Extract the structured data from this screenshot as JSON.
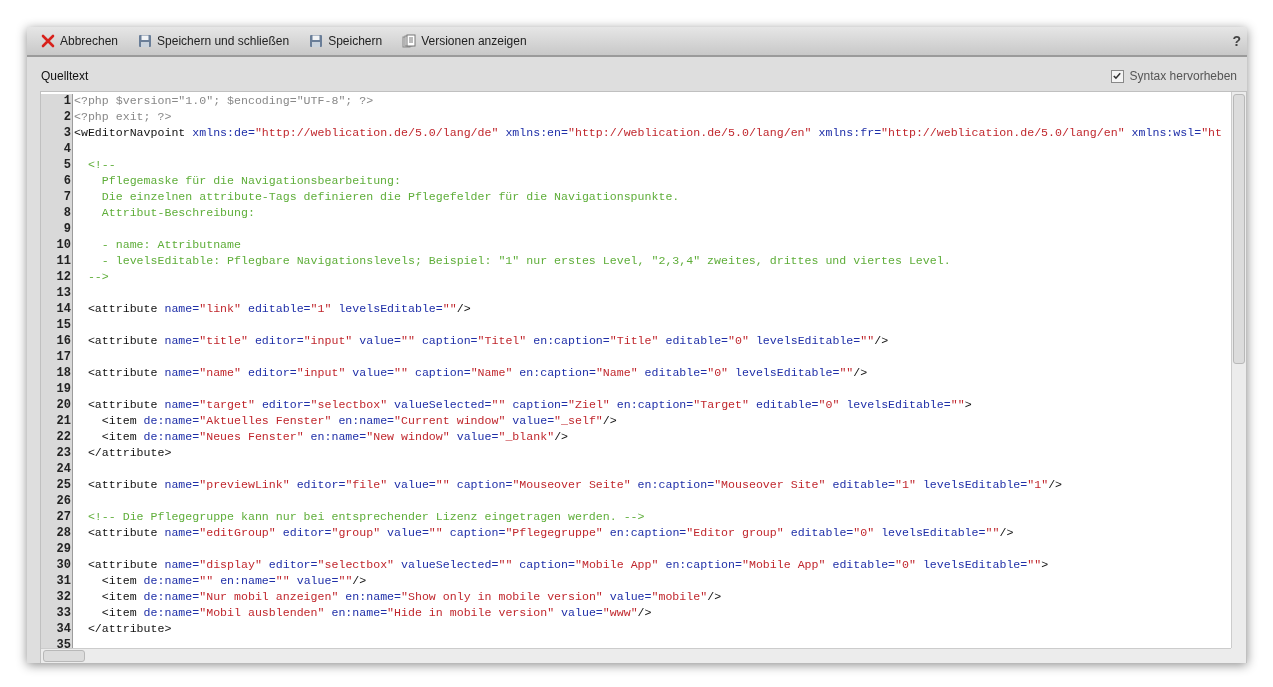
{
  "toolbar": {
    "buttons": [
      {
        "kind": "cancel",
        "label": "Abbrechen"
      },
      {
        "kind": "save",
        "label": "Speichern und schließen"
      },
      {
        "kind": "save",
        "label": "Speichern"
      },
      {
        "kind": "versions",
        "label": "Versionen anzeigen"
      }
    ],
    "help": "?"
  },
  "panel": {
    "title": "Quelltext",
    "highlight_option": {
      "label": "Syntax hervorheben",
      "checked": true
    }
  },
  "editor": {
    "lines": [
      {
        "number": "1",
        "tokens": [
          {
            "kind": "php",
            "text": "<?php $version=\"1.0\"; $encoding=\"UTF-8\"; ?>"
          }
        ]
      },
      {
        "number": "2",
        "tokens": [
          {
            "kind": "php",
            "text": "<?php exit; ?>"
          }
        ]
      },
      {
        "number": "3",
        "tokens": [
          {
            "kind": "tag",
            "text": "<wEditorNavpoint"
          },
          {
            "kind": "attr",
            "text": " xmlns:de="
          },
          {
            "kind": "value",
            "text": "\"http://weblication.de/5.0/lang/de\""
          },
          {
            "kind": "attr",
            "text": " xmlns:en="
          },
          {
            "kind": "value",
            "text": "\"http://weblication.de/5.0/lang/en\""
          },
          {
            "kind": "attr",
            "text": " xmlns:fr="
          },
          {
            "kind": "value",
            "text": "\"http://weblication.de/5.0/lang/en\""
          },
          {
            "kind": "attr",
            "text": " xmlns:wsl="
          },
          {
            "kind": "value",
            "text": "\"ht"
          }
        ]
      },
      {
        "number": "4"
      },
      {
        "number": "5",
        "tokens": [
          {
            "kind": "comment",
            "text": "  <!--"
          }
        ]
      },
      {
        "number": "6",
        "tokens": [
          {
            "kind": "comment",
            "text": "    Pflegemaske für die Navigationsbearbeitung:"
          }
        ]
      },
      {
        "number": "7",
        "tokens": [
          {
            "kind": "comment",
            "text": "    Die einzelnen attribute-Tags definieren die Pflegefelder für die Navigationspunkte."
          }
        ]
      },
      {
        "number": "8",
        "tokens": [
          {
            "kind": "comment",
            "text": "    Attribut-Beschreibung:"
          }
        ]
      },
      {
        "number": "9"
      },
      {
        "number": "10",
        "tokens": [
          {
            "kind": "comment",
            "text": "    - name: Attributname"
          }
        ]
      },
      {
        "number": "11",
        "tokens": [
          {
            "kind": "comment",
            "text": "    - levelsEditable: Pflegbare Navigationslevels; Beispiel: \"1\" nur erstes Level, \"2,3,4\" zweites, drittes und viertes Level."
          }
        ]
      },
      {
        "number": "12",
        "tokens": [
          {
            "kind": "comment",
            "text": "  -->"
          }
        ]
      },
      {
        "number": "13"
      },
      {
        "number": "14",
        "tokens": [
          {
            "kind": "tag",
            "text": "  <attribute"
          },
          {
            "kind": "attr",
            "text": " name="
          },
          {
            "kind": "value",
            "text": "\"link\""
          },
          {
            "kind": "attr",
            "text": " editable="
          },
          {
            "kind": "value",
            "text": "\"1\""
          },
          {
            "kind": "attr",
            "text": " levelsEditable="
          },
          {
            "kind": "value",
            "text": "\"\""
          },
          {
            "kind": "tag",
            "text": "/>"
          }
        ]
      },
      {
        "number": "15"
      },
      {
        "number": "16",
        "tokens": [
          {
            "kind": "tag",
            "text": "  <attribute"
          },
          {
            "kind": "attr",
            "text": " name="
          },
          {
            "kind": "value",
            "text": "\"title\""
          },
          {
            "kind": "attr",
            "text": " editor="
          },
          {
            "kind": "value",
            "text": "\"input\""
          },
          {
            "kind": "attr",
            "text": " value="
          },
          {
            "kind": "value",
            "text": "\"\""
          },
          {
            "kind": "attr",
            "text": " caption="
          },
          {
            "kind": "value",
            "text": "\"Titel\""
          },
          {
            "kind": "attr",
            "text": " en:caption="
          },
          {
            "kind": "value",
            "text": "\"Title\""
          },
          {
            "kind": "attr",
            "text": " editable="
          },
          {
            "kind": "value",
            "text": "\"0\""
          },
          {
            "kind": "attr",
            "text": " levelsEditable="
          },
          {
            "kind": "value",
            "text": "\"\""
          },
          {
            "kind": "tag",
            "text": "/>"
          }
        ]
      },
      {
        "number": "17"
      },
      {
        "number": "18",
        "tokens": [
          {
            "kind": "tag",
            "text": "  <attribute"
          },
          {
            "kind": "attr",
            "text": " name="
          },
          {
            "kind": "value",
            "text": "\"name\""
          },
          {
            "kind": "attr",
            "text": " editor="
          },
          {
            "kind": "value",
            "text": "\"input\""
          },
          {
            "kind": "attr",
            "text": " value="
          },
          {
            "kind": "value",
            "text": "\"\""
          },
          {
            "kind": "attr",
            "text": " caption="
          },
          {
            "kind": "value",
            "text": "\"Name\""
          },
          {
            "kind": "attr",
            "text": " en:caption="
          },
          {
            "kind": "value",
            "text": "\"Name\""
          },
          {
            "kind": "attr",
            "text": " editable="
          },
          {
            "kind": "value",
            "text": "\"0\""
          },
          {
            "kind": "attr",
            "text": " levelsEditable="
          },
          {
            "kind": "value",
            "text": "\"\""
          },
          {
            "kind": "tag",
            "text": "/>"
          }
        ]
      },
      {
        "number": "19"
      },
      {
        "number": "20",
        "tokens": [
          {
            "kind": "tag",
            "text": "  <attribute"
          },
          {
            "kind": "attr",
            "text": " name="
          },
          {
            "kind": "value",
            "text": "\"target\""
          },
          {
            "kind": "attr",
            "text": " editor="
          },
          {
            "kind": "value",
            "text": "\"selectbox\""
          },
          {
            "kind": "attr",
            "text": " valueSelected="
          },
          {
            "kind": "value",
            "text": "\"\""
          },
          {
            "kind": "attr",
            "text": " caption="
          },
          {
            "kind": "value",
            "text": "\"Ziel\""
          },
          {
            "kind": "attr",
            "text": " en:caption="
          },
          {
            "kind": "value",
            "text": "\"Target\""
          },
          {
            "kind": "attr",
            "text": " editable="
          },
          {
            "kind": "value",
            "text": "\"0\""
          },
          {
            "kind": "attr",
            "text": " levelsEditable="
          },
          {
            "kind": "value",
            "text": "\"\""
          },
          {
            "kind": "tag",
            "text": ">"
          }
        ]
      },
      {
        "number": "21",
        "tokens": [
          {
            "kind": "tag",
            "text": "    <item"
          },
          {
            "kind": "attr",
            "text": " de:name="
          },
          {
            "kind": "value",
            "text": "\"Aktuelles Fenster\""
          },
          {
            "kind": "attr",
            "text": " en:name="
          },
          {
            "kind": "value",
            "text": "\"Current window\""
          },
          {
            "kind": "attr",
            "text": " value="
          },
          {
            "kind": "value",
            "text": "\"_self\""
          },
          {
            "kind": "tag",
            "text": "/>"
          }
        ]
      },
      {
        "number": "22",
        "tokens": [
          {
            "kind": "tag",
            "text": "    <item"
          },
          {
            "kind": "attr",
            "text": " de:name="
          },
          {
            "kind": "value",
            "text": "\"Neues Fenster\""
          },
          {
            "kind": "attr",
            "text": " en:name="
          },
          {
            "kind": "value",
            "text": "\"New window\""
          },
          {
            "kind": "attr",
            "text": " value="
          },
          {
            "kind": "value",
            "text": "\"_blank\""
          },
          {
            "kind": "tag",
            "text": "/>"
          }
        ]
      },
      {
        "number": "23",
        "tokens": [
          {
            "kind": "tag",
            "text": "  </attribute>"
          }
        ]
      },
      {
        "number": "24"
      },
      {
        "number": "25",
        "tokens": [
          {
            "kind": "tag",
            "text": "  <attribute"
          },
          {
            "kind": "attr",
            "text": " name="
          },
          {
            "kind": "value",
            "text": "\"previewLink\""
          },
          {
            "kind": "attr",
            "text": " editor="
          },
          {
            "kind": "value",
            "text": "\"file\""
          },
          {
            "kind": "attr",
            "text": " value="
          },
          {
            "kind": "value",
            "text": "\"\""
          },
          {
            "kind": "attr",
            "text": " caption="
          },
          {
            "kind": "value",
            "text": "\"Mouseover Seite\""
          },
          {
            "kind": "attr",
            "text": " en:caption="
          },
          {
            "kind": "value",
            "text": "\"Mouseover Site\""
          },
          {
            "kind": "attr",
            "text": " editable="
          },
          {
            "kind": "value",
            "text": "\"1\""
          },
          {
            "kind": "attr",
            "text": " levelsEditable="
          },
          {
            "kind": "value",
            "text": "\"1\""
          },
          {
            "kind": "tag",
            "text": "/>"
          }
        ]
      },
      {
        "number": "26"
      },
      {
        "number": "27",
        "tokens": [
          {
            "kind": "comment",
            "text": "  <!-- Die Pflegegruppe kann nur bei entsprechender Lizenz eingetragen werden. -->"
          }
        ]
      },
      {
        "number": "28",
        "tokens": [
          {
            "kind": "tag",
            "text": "  <attribute"
          },
          {
            "kind": "attr",
            "text": " name="
          },
          {
            "kind": "value",
            "text": "\"editGroup\""
          },
          {
            "kind": "attr",
            "text": " editor="
          },
          {
            "kind": "value",
            "text": "\"group\""
          },
          {
            "kind": "attr",
            "text": " value="
          },
          {
            "kind": "value",
            "text": "\"\""
          },
          {
            "kind": "attr",
            "text": " caption="
          },
          {
            "kind": "value",
            "text": "\"Pflegegruppe\""
          },
          {
            "kind": "attr",
            "text": " en:caption="
          },
          {
            "kind": "value",
            "text": "\"Editor group\""
          },
          {
            "kind": "attr",
            "text": " editable="
          },
          {
            "kind": "value",
            "text": "\"0\""
          },
          {
            "kind": "attr",
            "text": " levelsEditable="
          },
          {
            "kind": "value",
            "text": "\"\""
          },
          {
            "kind": "tag",
            "text": "/>"
          }
        ]
      },
      {
        "number": "29"
      },
      {
        "number": "30",
        "tokens": [
          {
            "kind": "tag",
            "text": "  <attribute"
          },
          {
            "kind": "attr",
            "text": " name="
          },
          {
            "kind": "value",
            "text": "\"display\""
          },
          {
            "kind": "attr",
            "text": " editor="
          },
          {
            "kind": "value",
            "text": "\"selectbox\""
          },
          {
            "kind": "attr",
            "text": " valueSelected="
          },
          {
            "kind": "value",
            "text": "\"\""
          },
          {
            "kind": "attr",
            "text": " caption="
          },
          {
            "kind": "value",
            "text": "\"Mobile App\""
          },
          {
            "kind": "attr",
            "text": " en:caption="
          },
          {
            "kind": "value",
            "text": "\"Mobile App\""
          },
          {
            "kind": "attr",
            "text": " editable="
          },
          {
            "kind": "value",
            "text": "\"0\""
          },
          {
            "kind": "attr",
            "text": " levelsEditable="
          },
          {
            "kind": "value",
            "text": "\"\""
          },
          {
            "kind": "tag",
            "text": ">"
          }
        ]
      },
      {
        "number": "31",
        "tokens": [
          {
            "kind": "tag",
            "text": "    <item"
          },
          {
            "kind": "attr",
            "text": " de:name="
          },
          {
            "kind": "value",
            "text": "\"\""
          },
          {
            "kind": "attr",
            "text": " en:name="
          },
          {
            "kind": "value",
            "text": "\"\""
          },
          {
            "kind": "attr",
            "text": " value="
          },
          {
            "kind": "value",
            "text": "\"\""
          },
          {
            "kind": "tag",
            "text": "/>"
          }
        ]
      },
      {
        "number": "32",
        "tokens": [
          {
            "kind": "tag",
            "text": "    <item"
          },
          {
            "kind": "attr",
            "text": " de:name="
          },
          {
            "kind": "value",
            "text": "\"Nur mobil anzeigen\""
          },
          {
            "kind": "attr",
            "text": " en:name="
          },
          {
            "kind": "value",
            "text": "\"Show only in mobile version\""
          },
          {
            "kind": "attr",
            "text": " value="
          },
          {
            "kind": "value",
            "text": "\"mobile\""
          },
          {
            "kind": "tag",
            "text": "/>"
          }
        ]
      },
      {
        "number": "33",
        "tokens": [
          {
            "kind": "tag",
            "text": "    <item"
          },
          {
            "kind": "attr",
            "text": " de:name="
          },
          {
            "kind": "value",
            "text": "\"Mobil ausblenden\""
          },
          {
            "kind": "attr",
            "text": " en:name="
          },
          {
            "kind": "value",
            "text": "\"Hide in mobile version\""
          },
          {
            "kind": "attr",
            "text": " value="
          },
          {
            "kind": "value",
            "text": "\"www\""
          },
          {
            "kind": "tag",
            "text": "/>"
          }
        ]
      },
      {
        "number": "34",
        "tokens": [
          {
            "kind": "tag",
            "text": "  </attribute>"
          }
        ]
      },
      {
        "number": "35"
      }
    ]
  }
}
